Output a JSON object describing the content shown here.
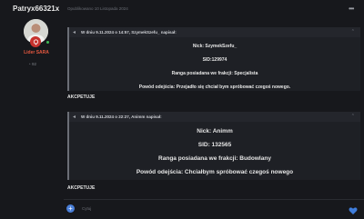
{
  "author": {
    "name": "Patryx66321x",
    "rank_title": "Lider SARA",
    "reputation": "92"
  },
  "post": {
    "date": "Opublikowano 10 Listopada 2024"
  },
  "quotes": [
    {
      "header": "W dniu 9.11.2024 o 14:57, SzymekSzefu_ napisał:",
      "lines": [
        "Nick: SzymekSzefu_",
        "SID:129974",
        "Ranga posiadana we frakcji: Specjalista",
        "Powód odejścia: Przejadło się chciał bym spróbować czegoś nowego."
      ],
      "answer": "AKCPETUJE"
    },
    {
      "header": "W dniu 9.11.2024 o 22:27, Animm napisał:",
      "lines": [
        "Nick: Animm",
        "SID: 132565",
        "Ranga posiadana we frakcji: Budowlany",
        "Powód odejścia: Chciałbym spróbować czegoś nowego"
      ],
      "answer": "AKCPETUJE"
    }
  ],
  "reply": {
    "placeholder": "Cytuj"
  },
  "icons": {
    "more": "more-dots-icon",
    "quote_arrow": "quote-arrow-icon",
    "collapse": "collapse-icon",
    "rank_badge": "rank-badge-icon",
    "reputation": "reputation-icon",
    "reply_add": "plus-icon",
    "like": "heart-icon"
  },
  "colors": {
    "background": "#17181c",
    "quote_bg": "#1e2025",
    "rank": "#e3573f",
    "accent": "#4a7fd8",
    "online": "#3fba55"
  }
}
